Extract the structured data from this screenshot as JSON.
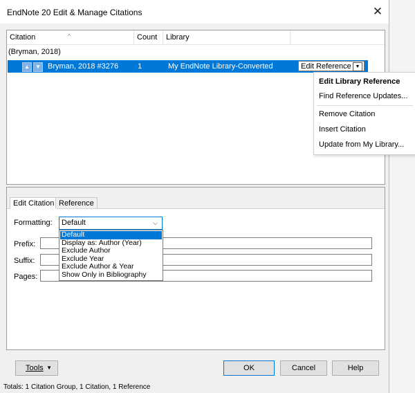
{
  "window": {
    "title": "EndNote 20 Edit & Manage Citations",
    "close_glyph": "✕"
  },
  "list": {
    "columns": [
      "Citation",
      "Count",
      "Library"
    ],
    "group_label": "(Bryman, 2018)",
    "selected_row": {
      "citation": "Bryman, 2018 #3276",
      "count": "1",
      "library": "My EndNote Library-Converted",
      "action": "Edit Reference"
    }
  },
  "context_menu": {
    "items": [
      "Edit Library Reference",
      "Find Reference Updates...",
      "Remove Citation",
      "Insert Citation",
      "Update from My Library..."
    ]
  },
  "tabs": [
    "Edit Citation",
    "Reference"
  ],
  "form": {
    "formatting_label": "Formatting:",
    "formatting_value": "Default",
    "prefix_label": "Prefix:",
    "suffix_label": "Suffix:",
    "pages_label": "Pages:",
    "formatting_options": [
      "Default",
      "Display as: Author (Year)",
      "Exclude Author",
      "Exclude Year",
      "Exclude Author & Year",
      "Show Only in Bibliography"
    ]
  },
  "buttons": {
    "tools": "Tools",
    "ok": "OK",
    "cancel": "Cancel",
    "help": "Help"
  },
  "status": "Totals: 1 Citation Group, 1 Citation, 1 Reference",
  "colors": {
    "selection": "#0078d7",
    "window_bg": "#f0f0f0"
  }
}
